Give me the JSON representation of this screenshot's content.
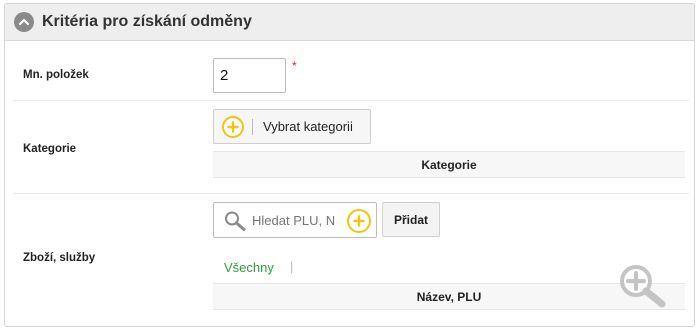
{
  "panel": {
    "title": "Kritéria pro získání odměny",
    "collapse_icon": "chevron-up-icon"
  },
  "quantity_row": {
    "label": "Mn. položek",
    "value": "2",
    "required_mark": "*"
  },
  "category_row": {
    "label": "Kategorie",
    "select_button_label": "Vybrat kategorii",
    "table_header": "Kategorie"
  },
  "products_row": {
    "label": "Zboží, služby",
    "search_placeholder": "Hledat PLU, N",
    "add_button_label": "Přidat",
    "filter_all_label": "Všechny",
    "filter_separator": "|",
    "table_header": "Název, PLU"
  },
  "colors": {
    "accent_yellow": "#f1c40f",
    "link_green": "#2e9e3c",
    "required_red": "#d9272e"
  },
  "icons": [
    "chevron-up-icon",
    "plus-circle-icon",
    "search-icon",
    "zoom-in-icon"
  ]
}
